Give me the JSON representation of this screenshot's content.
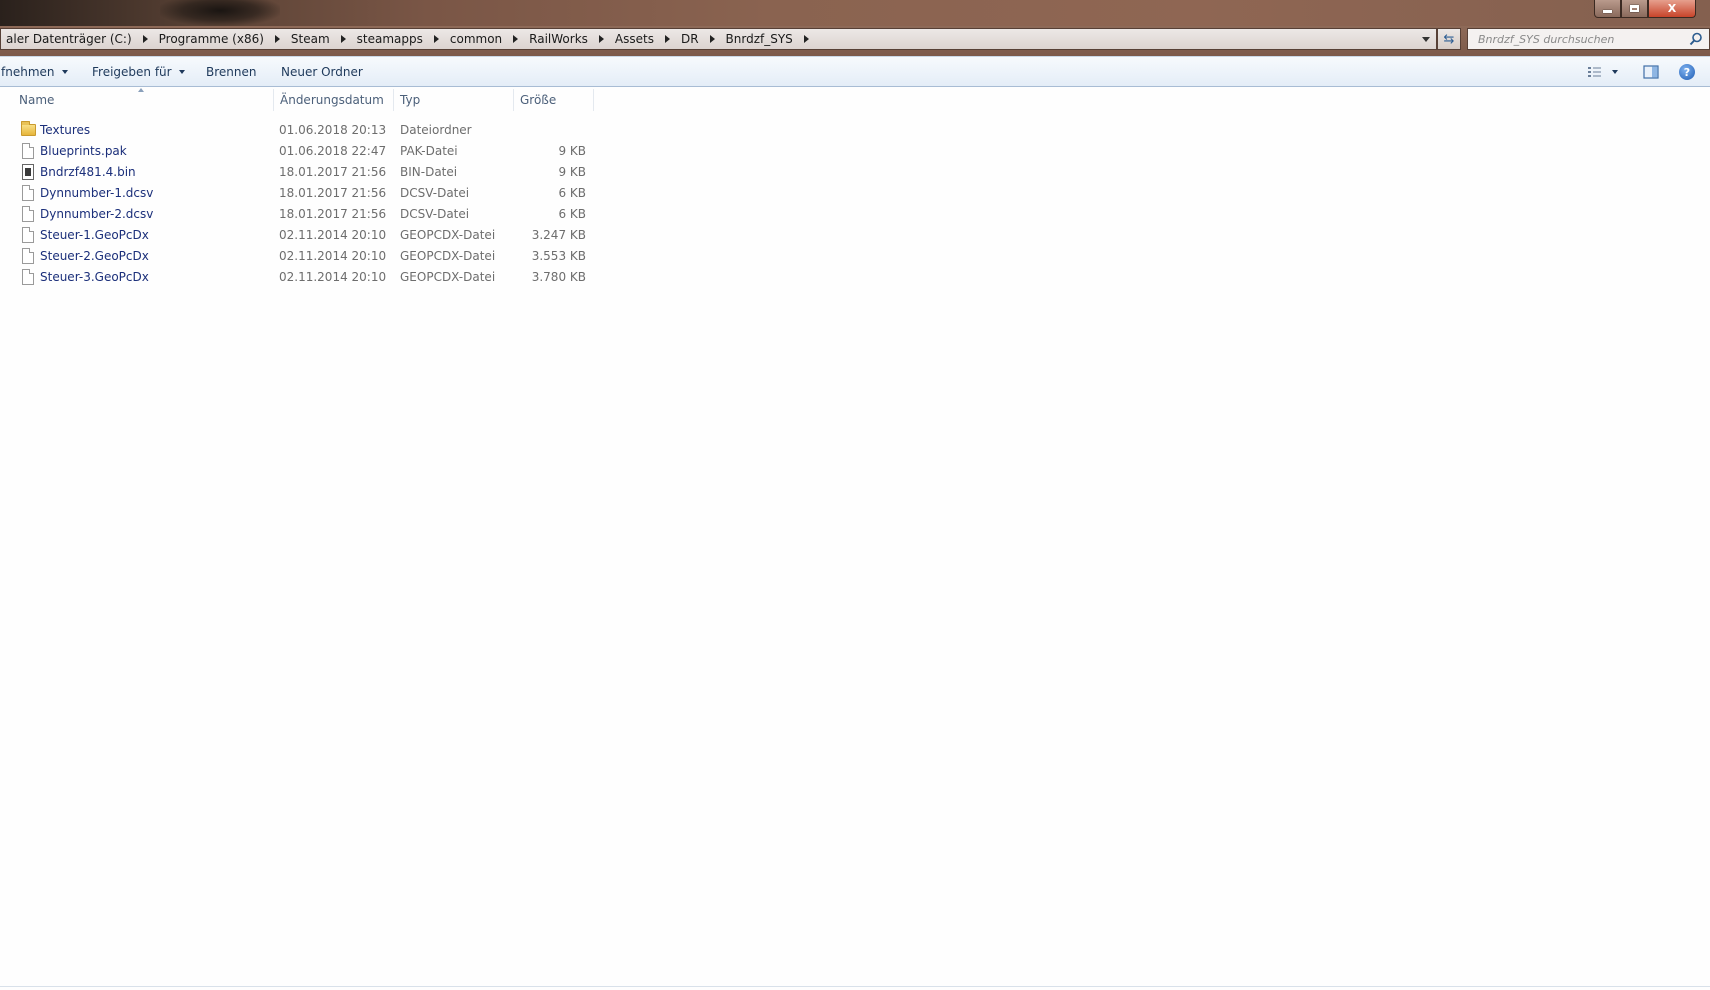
{
  "window": {
    "minimize_symbol": "",
    "close_symbol": "X"
  },
  "address": {
    "crumbs": [
      "aler Datenträger (C:)",
      "Programme (x86)",
      "Steam",
      "steamapps",
      "common",
      "RailWorks",
      "Assets",
      "DR",
      "Bnrdzf_SYS"
    ],
    "refresh_symbol": "⇆"
  },
  "search": {
    "placeholder": "Bnrdzf_SYS durchsuchen"
  },
  "toolbar": {
    "organize_label": "fnehmen",
    "share_label": "Freigeben für",
    "burn_label": "Brennen",
    "new_folder_label": "Neuer Ordner",
    "help_label": "?"
  },
  "columns": {
    "name": "Name",
    "date": "Änderungsdatum",
    "type": "Typ",
    "size": "Größe"
  },
  "files": [
    {
      "name": "Textures",
      "date": "01.06.2018 20:13",
      "type": "Dateiordner",
      "size": "",
      "icon": "folder"
    },
    {
      "name": "Blueprints.pak",
      "date": "01.06.2018 22:47",
      "type": "PAK-Datei",
      "size": "9 KB",
      "icon": "doc"
    },
    {
      "name": "Bndrzf481.4.bin",
      "date": "18.01.2017 21:56",
      "type": "BIN-Datei",
      "size": "9 KB",
      "icon": "bin"
    },
    {
      "name": "Dynnumber-1.dcsv",
      "date": "18.01.2017 21:56",
      "type": "DCSV-Datei",
      "size": "6 KB",
      "icon": "doc"
    },
    {
      "name": "Dynnumber-2.dcsv",
      "date": "18.01.2017 21:56",
      "type": "DCSV-Datei",
      "size": "6 KB",
      "icon": "doc"
    },
    {
      "name": "Steuer-1.GeoPcDx",
      "date": "02.11.2014 20:10",
      "type": "GEOPCDX-Datei",
      "size": "3.247 KB",
      "icon": "doc"
    },
    {
      "name": "Steuer-2.GeoPcDx",
      "date": "02.11.2014 20:10",
      "type": "GEOPCDX-Datei",
      "size": "3.553 KB",
      "icon": "doc"
    },
    {
      "name": "Steuer-3.GeoPcDx",
      "date": "02.11.2014 20:10",
      "type": "GEOPCDX-Datei",
      "size": "3.780 KB",
      "icon": "doc"
    }
  ]
}
